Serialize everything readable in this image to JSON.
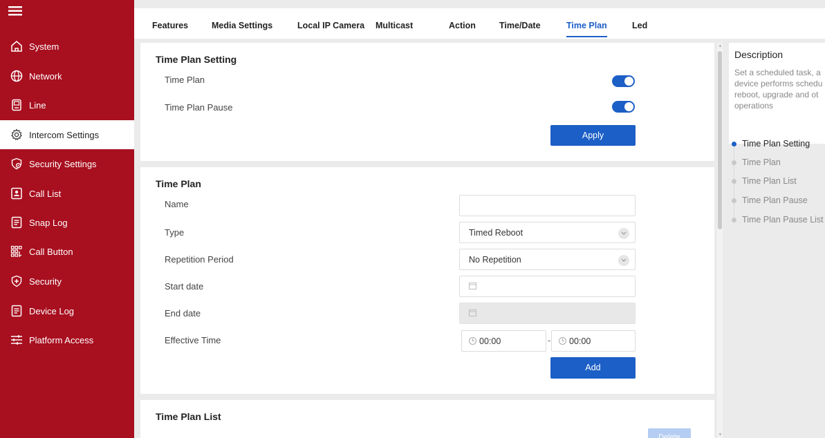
{
  "tabs": [
    {
      "label": "Features"
    },
    {
      "label": "Media Settings"
    },
    {
      "label": "Local IP Camera"
    },
    {
      "label": "Multicast"
    },
    {
      "label": "Action"
    },
    {
      "label": "Time/Date"
    },
    {
      "label": "Time Plan",
      "active": true
    },
    {
      "label": "Led"
    }
  ],
  "sidebar": {
    "items": [
      {
        "label": "System",
        "icon": "home-icon"
      },
      {
        "label": "Network",
        "icon": "globe-icon"
      },
      {
        "label": "Line",
        "icon": "phone-icon"
      },
      {
        "label": "Intercom Settings",
        "icon": "gear-icon",
        "active": true
      },
      {
        "label": "Security Settings",
        "icon": "shield-gear-icon"
      },
      {
        "label": "Call List",
        "icon": "contact-card-icon"
      },
      {
        "label": "Snap Log",
        "icon": "document-icon"
      },
      {
        "label": "Call Button",
        "icon": "grid-buttons-icon"
      },
      {
        "label": "Security",
        "icon": "shield-plus-icon"
      },
      {
        "label": "Device Log",
        "icon": "document-icon"
      },
      {
        "label": "Platform Access",
        "icon": "sliders-icon"
      }
    ]
  },
  "time_plan_setting": {
    "title": "Time Plan Setting",
    "time_plan_label": "Time Plan",
    "time_plan_on": true,
    "pause_label": "Time Plan Pause",
    "pause_on": true,
    "apply_label": "Apply"
  },
  "time_plan": {
    "title": "Time Plan",
    "name_label": "Name",
    "name_value": "",
    "type_label": "Type",
    "type_value": "Timed Reboot",
    "repetition_label": "Repetition Period",
    "repetition_value": "No Repetition",
    "start_label": "Start date",
    "end_label": "End date",
    "effective_label": "Effective Time",
    "effective_start": "00:00",
    "effective_sep": "-",
    "effective_end": "00:00",
    "add_label": "Add"
  },
  "time_plan_list": {
    "title": "Time Plan List",
    "delete_label": "Delete"
  },
  "description": {
    "title": "Description",
    "lines": [
      "Set a scheduled task, a",
      "device performs schedu",
      "reboot, upgrade and ot",
      "operations"
    ]
  },
  "anchors": [
    {
      "label": "Time Plan Setting",
      "active": true
    },
    {
      "label": "Time Plan"
    },
    {
      "label": "Time Plan List"
    },
    {
      "label": "Time Plan Pause"
    },
    {
      "label": "Time Plan Pause List"
    }
  ],
  "colors": {
    "sidebar": "#a80f1f",
    "accent": "#1c5fc6"
  }
}
